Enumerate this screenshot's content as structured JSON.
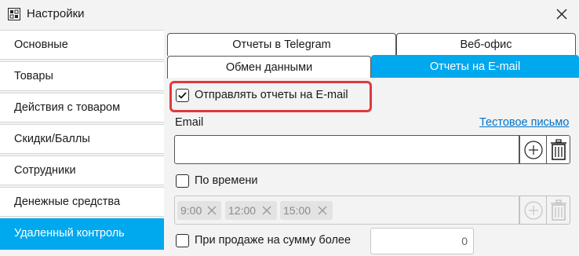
{
  "window": {
    "title": "Настройки"
  },
  "sidebar": {
    "items": [
      {
        "label": "Основные"
      },
      {
        "label": "Товары"
      },
      {
        "label": "Действия с товаром"
      },
      {
        "label": "Скидки/Баллы"
      },
      {
        "label": "Сотрудники"
      },
      {
        "label": "Денежные средства"
      },
      {
        "label": "Удаленный контроль",
        "active": true
      }
    ]
  },
  "tabs": {
    "row1": [
      {
        "label": "Отчеты в Telegram"
      },
      {
        "label": "Веб-офис"
      }
    ],
    "row2": [
      {
        "label": "Обмен данными"
      },
      {
        "label": "Отчеты на E-mail",
        "active": true
      }
    ]
  },
  "email_panel": {
    "send_reports_label": "Отправлять отчеты на E-mail",
    "send_reports_checked": true,
    "email_label": "Email",
    "test_email_link": "Тестовое письмо",
    "email_value": "",
    "by_time_label": "По времени",
    "by_time_checked": false,
    "time_chips": [
      "9:00",
      "12:00",
      "15:00"
    ],
    "on_sale_label": "При продаже на сумму более",
    "on_sale_checked": false,
    "on_sale_amount": "0"
  },
  "colors": {
    "accent": "#00a8ee",
    "highlight": "#e2383b",
    "link": "#0072c6"
  }
}
